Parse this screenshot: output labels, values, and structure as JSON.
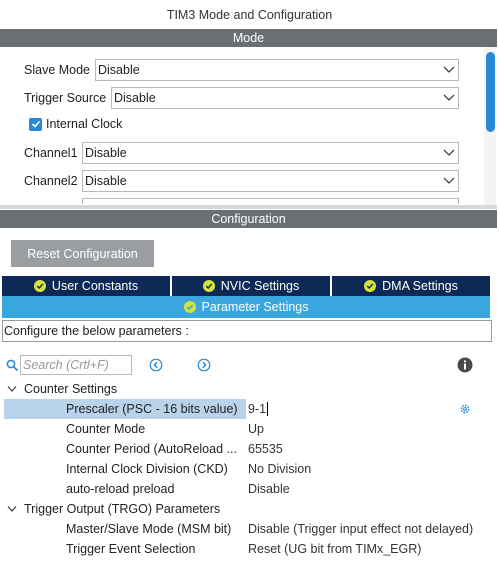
{
  "window": {
    "title": "TIM3 Mode and Configuration"
  },
  "mode": {
    "header": "Mode",
    "slave_mode": {
      "label": "Slave Mode",
      "value": "Disable"
    },
    "trigger_source": {
      "label": "Trigger Source",
      "value": "Disable"
    },
    "internal_clock": {
      "label": "Internal Clock",
      "checked": true
    },
    "channel1": {
      "label": "Channel1",
      "value": "Disable"
    },
    "channel2": {
      "label": "Channel2",
      "value": "Disable"
    }
  },
  "configuration": {
    "header": "Configuration",
    "reset_button": "Reset Configuration",
    "tabs": [
      {
        "label": "User Constants"
      },
      {
        "label": "NVIC Settings"
      },
      {
        "label": "DMA Settings"
      },
      {
        "label": "Parameter Settings",
        "active": true
      }
    ],
    "configure_text": "Configure the below parameters :",
    "search": {
      "placeholder": "Search (Crtl+F)"
    },
    "groups": [
      {
        "label": "Counter Settings",
        "params": [
          {
            "name": "Prescaler (PSC - 16 bits value)",
            "value": "9-1",
            "selected": true
          },
          {
            "name": "Counter Mode",
            "value": "Up"
          },
          {
            "name": "Counter Period (AutoReload ...",
            "value": "65535"
          },
          {
            "name": "Internal Clock Division (CKD)",
            "value": "No Division"
          },
          {
            "name": "auto-reload preload",
            "value": "Disable"
          }
        ]
      },
      {
        "label": "Trigger Output (TRGO) Parameters",
        "params": [
          {
            "name": "Master/Slave Mode (MSM bit)",
            "value": "Disable (Trigger input effect not delayed)"
          },
          {
            "name": "Trigger Event Selection",
            "value": "Reset (UG bit from TIMx_EGR)"
          }
        ]
      }
    ]
  },
  "colors": {
    "section_bar": "#6a6f73",
    "tab_dark": "#0c2a55",
    "tab_active": "#39a6de",
    "accent": "#2a89d3",
    "tick": "#d8e23a",
    "selection": "#b9d3ea"
  }
}
